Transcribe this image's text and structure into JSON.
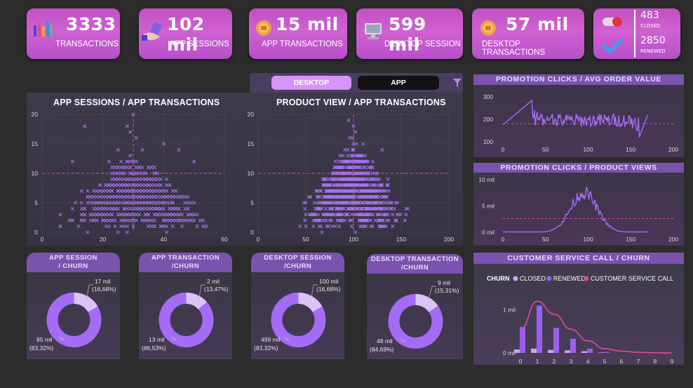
{
  "kpis": [
    {
      "value": "3333",
      "label": "TRANSACTIONS",
      "icon": "bar-chart-icon"
    },
    {
      "value": "102 mil",
      "label": "APP SESSIONS",
      "icon": "hand-phone-icon"
    },
    {
      "value": "15 mil",
      "label": "APP TRANSACTIONS",
      "icon": "coin-icon"
    },
    {
      "value": "599 mil",
      "label": "DESKTOP SESSION",
      "icon": "computer-icon"
    },
    {
      "value": "57 mil",
      "label": "DESKTOP TRANSACTIONS",
      "icon": "coin-icon"
    }
  ],
  "status_card": {
    "closed_value": "483",
    "closed_label": "CLOSED",
    "renewed_value": "2850",
    "renewed_label": "RENEWED"
  },
  "toggle": {
    "desktop": "DESKTOP",
    "app": "APP",
    "active": "DESKTOP"
  },
  "charts": {
    "scatter1": {
      "type": "scatter",
      "title": "APP SESSIONS / APP TRANSACTIONS",
      "xlim": [
        0,
        60
      ],
      "ylim": [
        0,
        20
      ],
      "xticks": [
        "0",
        "20",
        "40",
        "60"
      ],
      "yticks": [
        "0",
        "5",
        "10",
        "15",
        "20"
      ],
      "ref_x": 30,
      "ref_y": 10
    },
    "scatter2": {
      "type": "scatter",
      "title": "PRODUCT VIEW / APP TRANSACTIONS",
      "xlim": [
        0,
        200
      ],
      "ylim": [
        0,
        20
      ],
      "xticks": [
        "0",
        "50",
        "100",
        "150",
        "200"
      ],
      "yticks": [
        "0",
        "5",
        "10",
        "15",
        "20"
      ],
      "ref_x": 100,
      "ref_y": 10
    },
    "line1": {
      "type": "line",
      "title": "PROMOTION CLICKS / AVG ORDER VALUE",
      "xticks": [
        "0",
        "50",
        "100",
        "150",
        "200"
      ],
      "yticks": [
        "100",
        "200",
        "300"
      ],
      "xlim": [
        0,
        200
      ],
      "ylim": [
        100,
        300
      ],
      "ref_y": 180
    },
    "line2": {
      "type": "line",
      "title": "PROMOTION CLICKS / PRODUCT VIEWS",
      "xticks": [
        "0",
        "50",
        "100",
        "150",
        "200"
      ],
      "yticks": [
        "0 mil",
        "5 mil",
        "10 mil"
      ],
      "xlim": [
        0,
        200
      ],
      "ylim": [
        0,
        10
      ],
      "ref_y": 2.6
    },
    "combo": {
      "type": "bar",
      "title": "CUSTOMER SERVICE CALL / CHURN",
      "legend_title": "CHURN",
      "legend": [
        {
          "name": "CLOSED",
          "color": "#c8a8ee"
        },
        {
          "name": "RENEWED",
          "color": "#9b5ef0"
        },
        {
          "name": "CUSTOMER SERVICE CALL",
          "color": "#e3489a"
        }
      ],
      "categories": [
        "0",
        "1",
        "2",
        "3",
        "4",
        "5",
        "6",
        "7",
        "8",
        "9"
      ],
      "yticks": [
        "0 mil",
        "1 mil"
      ],
      "closed": [
        0.08,
        0.1,
        0.07,
        0.06,
        0.04,
        0.01,
        0.0,
        0.0,
        0.0,
        0.0
      ],
      "renewed": [
        0.6,
        1.1,
        0.58,
        0.33,
        0.1,
        0.02,
        0.0,
        0.0,
        0.0,
        0.0
      ],
      "line": [
        0.55,
        1.2,
        0.9,
        0.55,
        0.28,
        0.1,
        0.04,
        0.015,
        0.005,
        0.0
      ],
      "ylim": [
        0,
        1.4
      ]
    }
  },
  "donuts": [
    {
      "title1": "APP SESSION",
      "title2": "/ CHURN",
      "small_value": "17 mil",
      "small_pct": "(16,68%)",
      "big_value": "85 mil",
      "big_pct": "(83,32%)",
      "small_frac": 0.1668
    },
    {
      "title1": "APP TRANSACTION",
      "title2": "/CHURN",
      "small_value": "2 mil",
      "small_pct": "(13,47%)",
      "big_value": "13 mil",
      "big_pct": "(86,53%)",
      "small_frac": 0.1347
    },
    {
      "title1": "DESKTOP SESSION",
      "title2": "/CHURN",
      "small_value": "100 mil",
      "small_pct": "(16,68%)",
      "big_value": "499 mil",
      "big_pct": "(83,32%)",
      "small_frac": 0.1668
    },
    {
      "title1": "DESKTOP TRANSACTION",
      "title2": "/CHURN",
      "small_value": "9 mil",
      "small_pct": "(15,31%)",
      "big_value": "48 mil",
      "big_pct": "(84,69%)",
      "small_frac": 0.1531
    }
  ],
  "colors": {
    "accent": "#a46cf5",
    "pink": "#e3489a",
    "light": "#cdb3f0",
    "title": "#7b52ad"
  }
}
